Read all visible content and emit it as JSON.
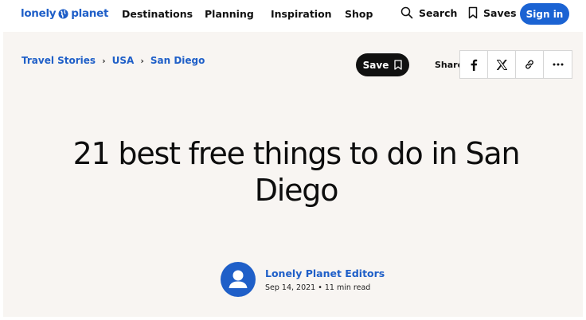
{
  "nav": {
    "logo_text_left": "lonely",
    "logo_text_right": "planet",
    "links": [
      "Destinations",
      "Planning",
      "Inspiration",
      "Shop"
    ],
    "search_label": "Search",
    "saves_label": "Saves",
    "signin_label": "Sign in"
  },
  "breadcrumb": [
    "Travel Stories",
    "USA",
    "San Diego"
  ],
  "actions": {
    "save_label": "Save",
    "share_label": "Share"
  },
  "article": {
    "title": "21 best free things to do in San Diego",
    "author": "Lonely Planet Editors",
    "meta": "Sep 14, 2021 • 11 min read"
  },
  "colors": {
    "brand_blue": "#1f5fc8",
    "signin_blue": "#1b63d3",
    "hero_bg": "#f8f5f2"
  }
}
